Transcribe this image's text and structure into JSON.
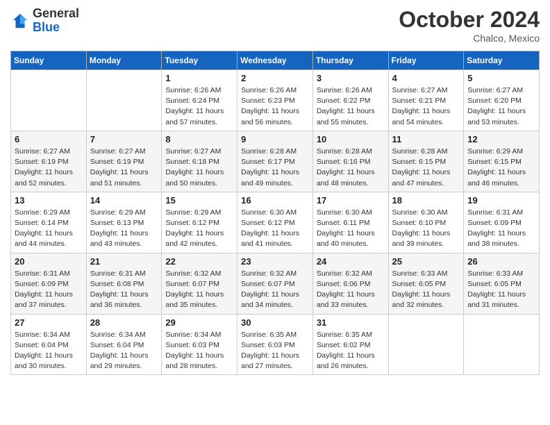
{
  "logo": {
    "general": "General",
    "blue": "Blue"
  },
  "title": {
    "month_year": "October 2024",
    "location": "Chalco, Mexico"
  },
  "days_of_week": [
    "Sunday",
    "Monday",
    "Tuesday",
    "Wednesday",
    "Thursday",
    "Friday",
    "Saturday"
  ],
  "weeks": [
    [
      {
        "day": "",
        "info": ""
      },
      {
        "day": "",
        "info": ""
      },
      {
        "day": "1",
        "info": "Sunrise: 6:26 AM\nSunset: 6:24 PM\nDaylight: 11 hours and 57 minutes."
      },
      {
        "day": "2",
        "info": "Sunrise: 6:26 AM\nSunset: 6:23 PM\nDaylight: 11 hours and 56 minutes."
      },
      {
        "day": "3",
        "info": "Sunrise: 6:26 AM\nSunset: 6:22 PM\nDaylight: 11 hours and 55 minutes."
      },
      {
        "day": "4",
        "info": "Sunrise: 6:27 AM\nSunset: 6:21 PM\nDaylight: 11 hours and 54 minutes."
      },
      {
        "day": "5",
        "info": "Sunrise: 6:27 AM\nSunset: 6:20 PM\nDaylight: 11 hours and 53 minutes."
      }
    ],
    [
      {
        "day": "6",
        "info": "Sunrise: 6:27 AM\nSunset: 6:19 PM\nDaylight: 11 hours and 52 minutes."
      },
      {
        "day": "7",
        "info": "Sunrise: 6:27 AM\nSunset: 6:19 PM\nDaylight: 11 hours and 51 minutes."
      },
      {
        "day": "8",
        "info": "Sunrise: 6:27 AM\nSunset: 6:18 PM\nDaylight: 11 hours and 50 minutes."
      },
      {
        "day": "9",
        "info": "Sunrise: 6:28 AM\nSunset: 6:17 PM\nDaylight: 11 hours and 49 minutes."
      },
      {
        "day": "10",
        "info": "Sunrise: 6:28 AM\nSunset: 6:16 PM\nDaylight: 11 hours and 48 minutes."
      },
      {
        "day": "11",
        "info": "Sunrise: 6:28 AM\nSunset: 6:15 PM\nDaylight: 11 hours and 47 minutes."
      },
      {
        "day": "12",
        "info": "Sunrise: 6:29 AM\nSunset: 6:15 PM\nDaylight: 11 hours and 46 minutes."
      }
    ],
    [
      {
        "day": "13",
        "info": "Sunrise: 6:29 AM\nSunset: 6:14 PM\nDaylight: 11 hours and 44 minutes."
      },
      {
        "day": "14",
        "info": "Sunrise: 6:29 AM\nSunset: 6:13 PM\nDaylight: 11 hours and 43 minutes."
      },
      {
        "day": "15",
        "info": "Sunrise: 6:29 AM\nSunset: 6:12 PM\nDaylight: 11 hours and 42 minutes."
      },
      {
        "day": "16",
        "info": "Sunrise: 6:30 AM\nSunset: 6:12 PM\nDaylight: 11 hours and 41 minutes."
      },
      {
        "day": "17",
        "info": "Sunrise: 6:30 AM\nSunset: 6:11 PM\nDaylight: 11 hours and 40 minutes."
      },
      {
        "day": "18",
        "info": "Sunrise: 6:30 AM\nSunset: 6:10 PM\nDaylight: 11 hours and 39 minutes."
      },
      {
        "day": "19",
        "info": "Sunrise: 6:31 AM\nSunset: 6:09 PM\nDaylight: 11 hours and 38 minutes."
      }
    ],
    [
      {
        "day": "20",
        "info": "Sunrise: 6:31 AM\nSunset: 6:09 PM\nDaylight: 11 hours and 37 minutes."
      },
      {
        "day": "21",
        "info": "Sunrise: 6:31 AM\nSunset: 6:08 PM\nDaylight: 11 hours and 36 minutes."
      },
      {
        "day": "22",
        "info": "Sunrise: 6:32 AM\nSunset: 6:07 PM\nDaylight: 11 hours and 35 minutes."
      },
      {
        "day": "23",
        "info": "Sunrise: 6:32 AM\nSunset: 6:07 PM\nDaylight: 11 hours and 34 minutes."
      },
      {
        "day": "24",
        "info": "Sunrise: 6:32 AM\nSunset: 6:06 PM\nDaylight: 11 hours and 33 minutes."
      },
      {
        "day": "25",
        "info": "Sunrise: 6:33 AM\nSunset: 6:05 PM\nDaylight: 11 hours and 32 minutes."
      },
      {
        "day": "26",
        "info": "Sunrise: 6:33 AM\nSunset: 6:05 PM\nDaylight: 11 hours and 31 minutes."
      }
    ],
    [
      {
        "day": "27",
        "info": "Sunrise: 6:34 AM\nSunset: 6:04 PM\nDaylight: 11 hours and 30 minutes."
      },
      {
        "day": "28",
        "info": "Sunrise: 6:34 AM\nSunset: 6:04 PM\nDaylight: 11 hours and 29 minutes."
      },
      {
        "day": "29",
        "info": "Sunrise: 6:34 AM\nSunset: 6:03 PM\nDaylight: 11 hours and 28 minutes."
      },
      {
        "day": "30",
        "info": "Sunrise: 6:35 AM\nSunset: 6:03 PM\nDaylight: 11 hours and 27 minutes."
      },
      {
        "day": "31",
        "info": "Sunrise: 6:35 AM\nSunset: 6:02 PM\nDaylight: 11 hours and 26 minutes."
      },
      {
        "day": "",
        "info": ""
      },
      {
        "day": "",
        "info": ""
      }
    ]
  ]
}
